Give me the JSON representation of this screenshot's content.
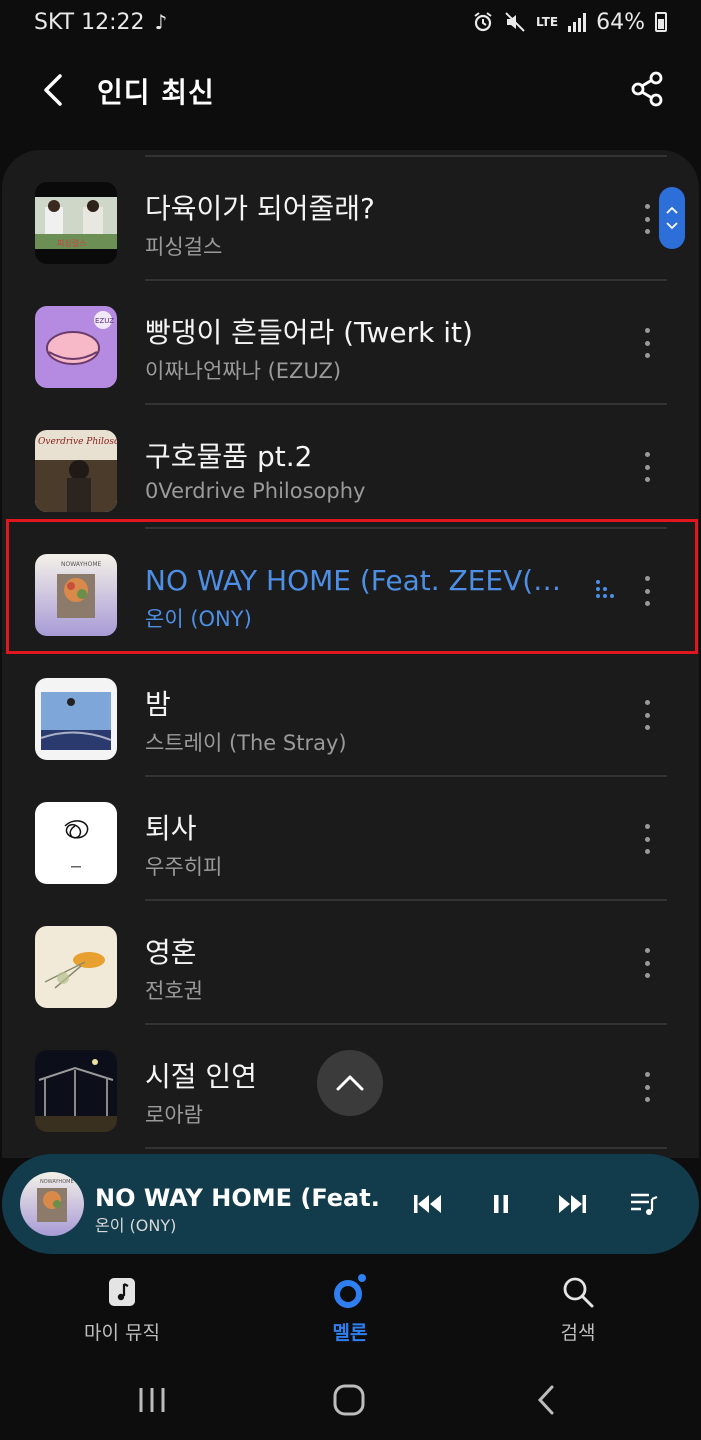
{
  "status_bar": {
    "carrier_time": "SKT 12:22",
    "lte_label": "LTE",
    "battery": "64%"
  },
  "header": {
    "title": "인디 최신"
  },
  "songs": [
    {
      "title": "다육이가 되어줄래?",
      "artist": "피싱걸스",
      "art_label": "피싱걸스"
    },
    {
      "title": "빵댕이 흔들어라 (Twerk it)",
      "artist": "이짜나언짜나 (EZUZ)",
      "art_label": "EZUZ"
    },
    {
      "title": "구호물품 pt.2",
      "artist": "0Verdrive Philosophy",
      "art_label": "Overdrive Philosophy"
    },
    {
      "title": "NO WAY HOME (Feat. ZEEV(지...",
      "artist": "온이 (ONY)",
      "art_label": "NOWAYHOME"
    },
    {
      "title": "밤",
      "artist": "스트레이 (The Stray)"
    },
    {
      "title": "퇴사",
      "artist": "우주히피"
    },
    {
      "title": "영혼",
      "artist": "전호권"
    },
    {
      "title": "시절 인연",
      "artist": "로아람"
    }
  ],
  "now_playing": {
    "title": "NO WAY HOME (Feat. ZEEV(지",
    "artist": "온이 (ONY)",
    "art_label": "NOWAYHOME"
  },
  "bottom_nav": {
    "my_music": "마이 뮤직",
    "melon": "멜론",
    "search": "검색"
  },
  "colors": {
    "accent": "#2f7ff0",
    "highlight": "#e0171f",
    "player_bg": "#123c4c"
  }
}
